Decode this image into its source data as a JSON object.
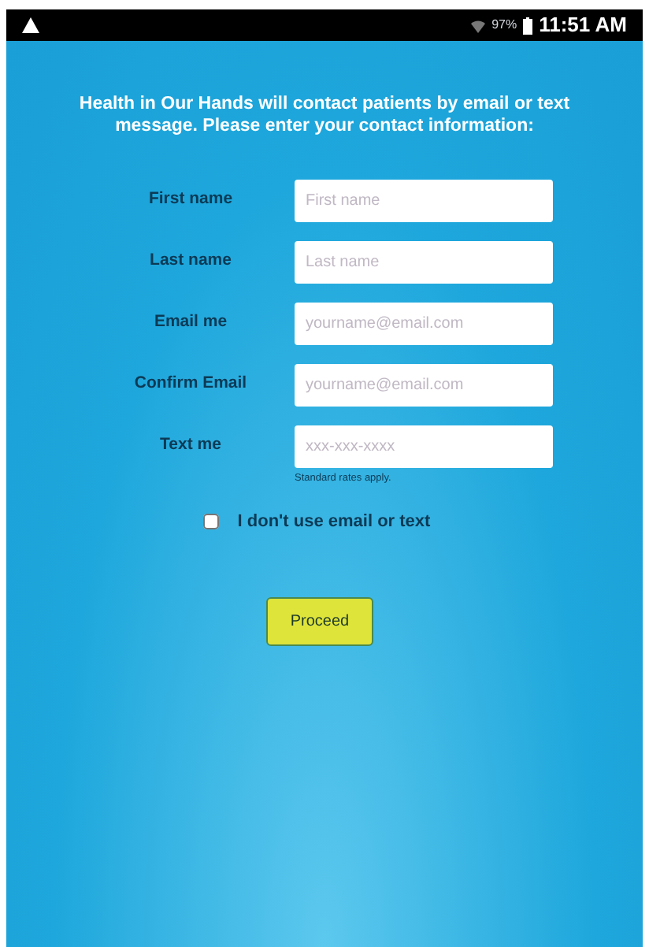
{
  "status_bar": {
    "battery": "97%",
    "time": "11:51 AM"
  },
  "intro": "Health in Our Hands will contact patients by email or text message. Please enter your contact information:",
  "fields": [
    {
      "label": "First name",
      "placeholder": "First name"
    },
    {
      "label": "Last name",
      "placeholder": "Last name"
    },
    {
      "label": "Email me",
      "placeholder": "yourname@email.com"
    },
    {
      "label": "Confirm Email",
      "placeholder": "yourname@email.com"
    },
    {
      "label": "Text me",
      "placeholder": "xxx-xxx-xxxx",
      "note": "Standard rates apply."
    }
  ],
  "opt_out": {
    "label": "I don't use email or text",
    "checked": false
  },
  "proceed_button": "Proceed"
}
